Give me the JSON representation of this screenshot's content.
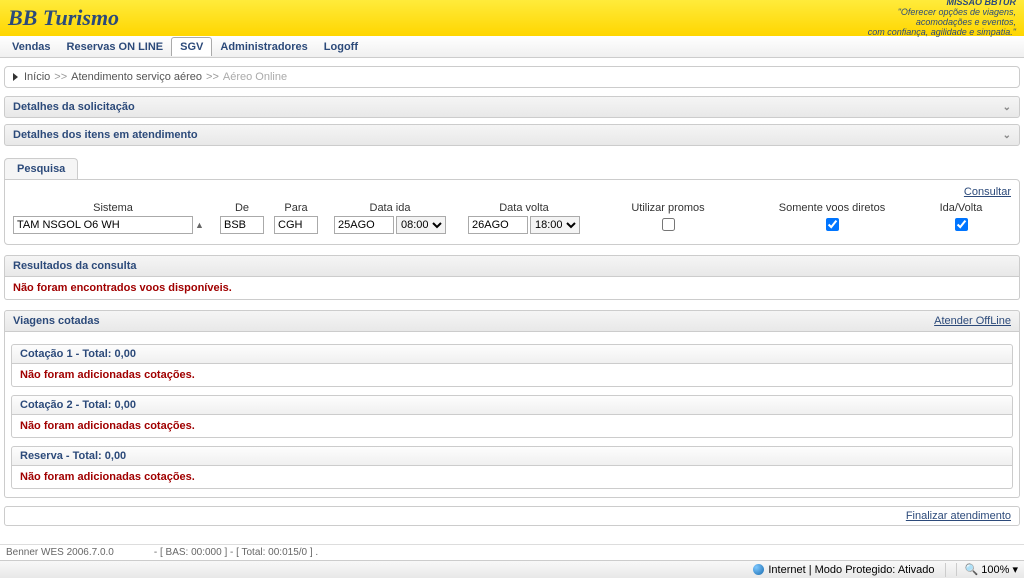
{
  "header": {
    "logo": "BB Turismo",
    "mission_title": "MISSÃO BBTUR",
    "mission_line1": "\"Oferecer opções de viagens,",
    "mission_line2": "acomodações e eventos,",
    "mission_line3": "com confiança, agilidade e simpatia.\""
  },
  "menu": {
    "vendas": "Vendas",
    "reservas": "Reservas ON LINE",
    "sgv": "SGV",
    "admin": "Administradores",
    "logoff": "Logoff"
  },
  "breadcrumb": {
    "inicio": "Início",
    "sep": ">>",
    "atendimento": "Atendimento serviço aéreo",
    "aereo": "Aéreo Online"
  },
  "panels": {
    "detalhes_solicitacao": "Detalhes da solicitação",
    "detalhes_itens": "Detalhes dos itens em atendimento"
  },
  "search": {
    "tab": "Pesquisa",
    "consultar": "Consultar",
    "labels": {
      "sistema": "Sistema",
      "de": "De",
      "para": "Para",
      "data_ida": "Data ida",
      "data_volta": "Data volta",
      "utilizar_promos": "Utilizar promos",
      "voos_diretos": "Somente voos diretos",
      "ida_volta": "Ida/Volta"
    },
    "values": {
      "sistema": "TAM NSGOL O6 WH",
      "de": "BSB",
      "para": "CGH",
      "data_ida": "25AGO",
      "hora_ida": "08:00",
      "data_volta": "26AGO",
      "hora_volta": "18:00"
    }
  },
  "results": {
    "header": "Resultados da consulta",
    "msg": "Não foram encontrados voos disponíveis."
  },
  "viagens": {
    "header": "Viagens cotadas",
    "offline": "Atender OffLine",
    "cotacao1": "Cotação 1 - Total: 0,00",
    "cotacao2": "Cotação 2 - Total: 0,00",
    "reserva": "Reserva - Total: 0,00",
    "msg": "Não foram adicionadas cotações."
  },
  "bottom": {
    "finalizar": "Finalizar atendimento"
  },
  "footer": {
    "version": "Benner WES 2006.7.0.0",
    "stats": "- [ BAS: 00:000 ] - [ Total: 00:015/0 ] ."
  },
  "statusbar": {
    "mode": "Internet | Modo Protegido: Ativado",
    "zoom": "100%"
  }
}
